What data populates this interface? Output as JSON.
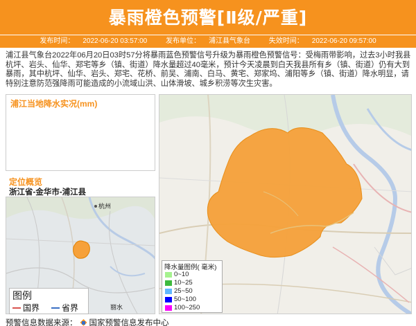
{
  "header": {
    "title": "暴雨橙色预警[Ⅱ级/严重]",
    "publish_time_label": "发布时间：",
    "publish_time": "2022-06-20 03:57:00",
    "publisher_label": "发布单位：",
    "publisher": "浦江县气象台",
    "expire_label": "失效时间：",
    "expire_time": "2022-06-20 09:57:00"
  },
  "description": "浦江县气象台2022年06月20日03时57分将暴雨蓝色预警信号升级为暴雨橙色预警信号：受梅雨带影响，过去3小时我县杭坪、岩头、仙华、郑宅等乡（镇、街道）降水量超过40毫米，预计今天凌晨到白天我县所有乡（镇、街道）仍有大到暴雨，其中杭坪、仙华、岩头、郑宅、花桥、前吴、浦南、白马、黄宅、郑家坞、浦阳等乡（镇、街道）降水明显，请特别注意防范强降雨可能造成的小流域山洪、山体滑坡、城乡积涝等次生灾害。",
  "rain_panel": {
    "title": "浦江当地降水实况(mm)"
  },
  "location": {
    "title": "定位概览",
    "path": "浙江省-金华市-浦江县",
    "map_labels": [
      "杭州",
      "丽水"
    ]
  },
  "map_legend": {
    "title": "图例",
    "items": [
      {
        "label": "国界",
        "color": "#d9534f"
      },
      {
        "label": "省界",
        "color": "#3a6fc4"
      }
    ]
  },
  "rain_legend": {
    "title": "降水量图例( 毫米)",
    "items": [
      {
        "label": "0~10",
        "color": "#a6f28f"
      },
      {
        "label": "10~25",
        "color": "#3dba3d"
      },
      {
        "label": "25~50",
        "color": "#61b8ff"
      },
      {
        "label": "50~100",
        "color": "#0000ff"
      },
      {
        "label": "100~250",
        "color": "#fa00fa"
      }
    ]
  },
  "footer": {
    "label": "预警信息数据来源：",
    "source": "国家预警信息发布中心"
  },
  "colors": {
    "accent": "#f6921e",
    "warning_area": "#f6a13a"
  }
}
